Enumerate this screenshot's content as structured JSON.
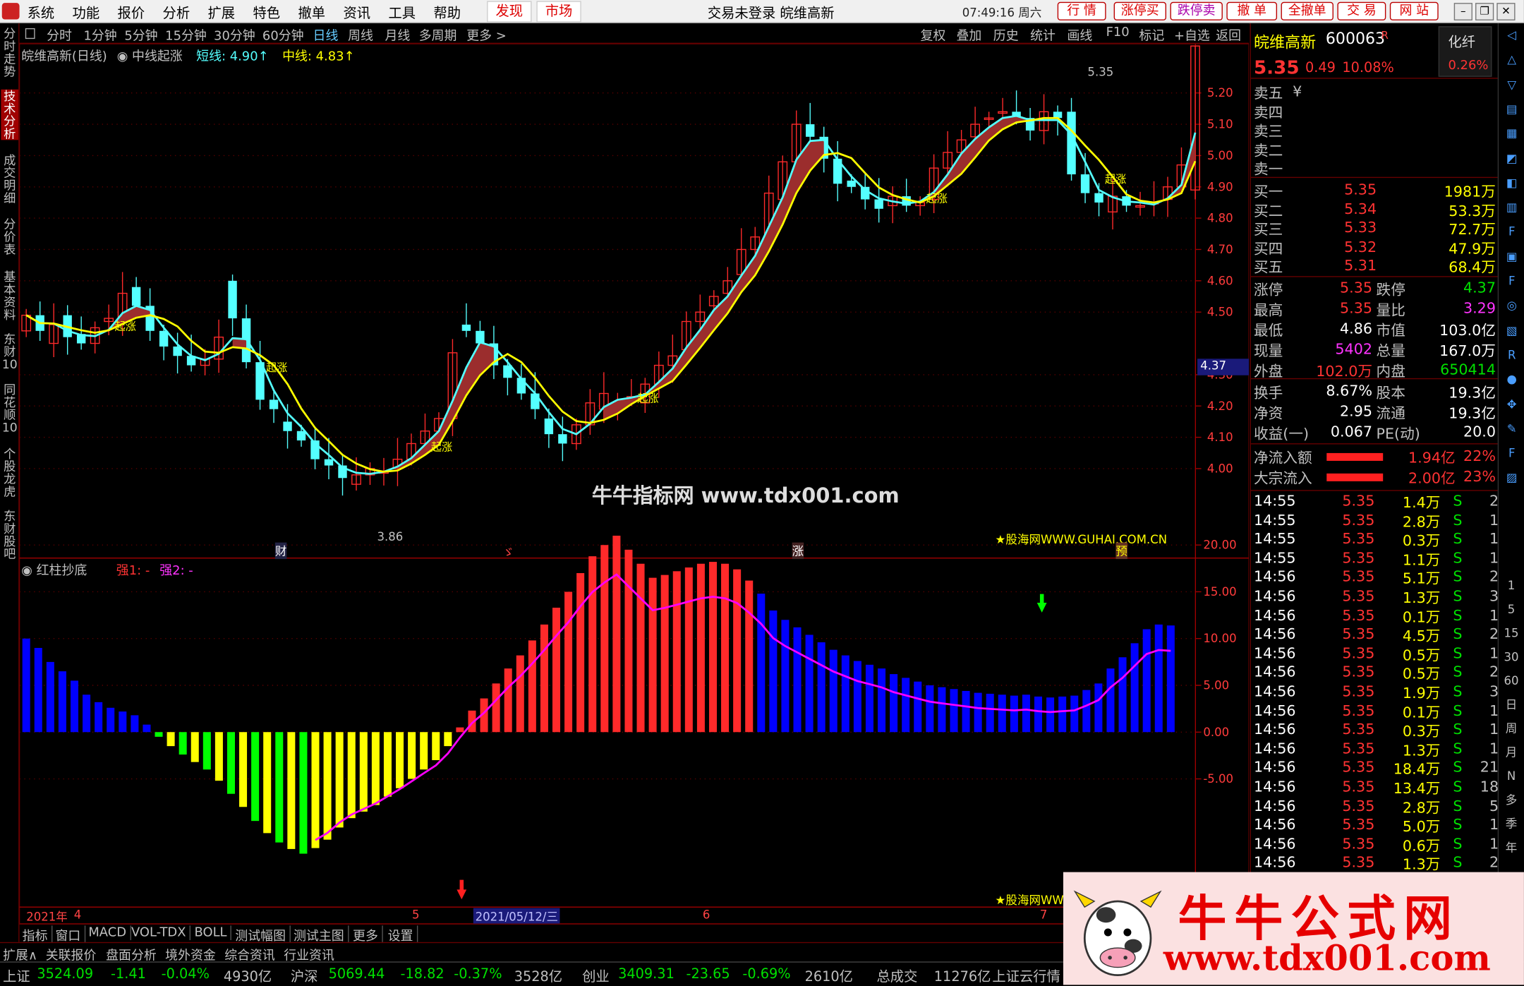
{
  "title_bar": {
    "menus": [
      "系统",
      "功能",
      "报价",
      "分析",
      "扩展",
      "特色",
      "撤单",
      "资讯",
      "工具",
      "帮助"
    ],
    "discover": "发现",
    "market": "市场",
    "center_text": "交易未登录 皖维高新",
    "clock": "07:49:16 周六",
    "buttons": [
      "行 情",
      "涨停买",
      "跌停卖",
      "撤 单",
      "全撤单",
      "交 易",
      "网 站"
    ]
  },
  "left_tabs": [
    "分时走势",
    "技术分析",
    "成交明细",
    "分价表",
    "基本资料",
    "东财10",
    "同花顺10",
    "个股龙虎",
    "东财股吧"
  ],
  "period_bar": {
    "items": [
      "分时",
      "1分钟",
      "5分钟",
      "15分钟",
      "30分钟",
      "60分钟",
      "日线",
      "周线",
      "月线",
      "多周期",
      "更多 >"
    ],
    "selected": "日线",
    "right_items": [
      "复权",
      "叠加",
      "历史",
      "统计",
      "画线",
      "F10",
      "标记",
      "+自选",
      "返回"
    ]
  },
  "main_chart": {
    "stock_label": "皖维高新(日线)",
    "indicator_name": "中线起涨",
    "short_label": "短线: 4.90↑",
    "mid_label": "中线: 4.83↑",
    "high_mark": "5.35",
    "low_mark": "3.86",
    "price_tag": "4.37",
    "marker_text": "起涨",
    "event_markers": [
      "财",
      "ゞ",
      "涨",
      "预"
    ],
    "watermark_center": "牛牛指标网 www.tdx001.com",
    "watermark_guhai": "★股海网WWW.GUHAI.COM.CN",
    "y_ticks": [
      "5.20",
      "5.10",
      "5.00",
      "4.90",
      "4.80",
      "4.70",
      "4.60",
      "4.50",
      "4.30",
      "4.20",
      "4.10",
      "4.00"
    ]
  },
  "sub_chart": {
    "indicator_name": "红柱抄底",
    "strong1": "强1: -",
    "strong2": "强2: -",
    "y_ticks": [
      "20.00",
      "15.00",
      "10.00",
      "5.00",
      "0.00",
      "-5.00"
    ],
    "watermark_guhai": "★股海网WW"
  },
  "chart_data": {
    "type": "bar",
    "title": "红柱抄底",
    "ylim": [
      -13,
      21
    ],
    "values": [
      10,
      9,
      7.5,
      6.5,
      5.5,
      4,
      3.2,
      2.6,
      2.2,
      1.8,
      0.8,
      -0.5,
      -1.5,
      -2.4,
      -3.2,
      -4,
      -5.2,
      -6.6,
      -8,
      -9.5,
      -10.8,
      -11.8,
      -12.5,
      -13,
      -12.4,
      -11.5,
      -10.2,
      -9.2,
      -8.5,
      -7.8,
      -6.9,
      -6,
      -5,
      -4,
      -3,
      -1.5,
      0.5,
      2.3,
      3.6,
      5.2,
      6.8,
      8.2,
      9.8,
      11.5,
      13.3,
      15,
      17,
      18.8,
      20,
      21,
      19.5,
      18,
      16.5,
      16.8,
      17.2,
      17.6,
      18,
      18.2,
      18,
      17.4,
      16.2,
      14.8,
      13,
      12,
      11.2,
      10.4,
      9.6,
      8.8,
      8.2,
      7.6,
      7.2,
      6.8,
      6.2,
      5.8,
      5.4,
      5,
      4.8,
      4.6,
      4.4,
      4.2,
      4.1,
      4,
      3.9,
      4,
      3.8,
      3.7,
      3.8,
      3.9,
      4.5,
      5.2,
      6.8,
      8,
      9.5,
      11,
      11.5,
      11.4
    ],
    "x": [
      "2021年4",
      "5",
      "2021/05/12/三",
      "6",
      "7"
    ]
  },
  "time_axis": {
    "labels": [
      "2021年",
      "4",
      "5",
      "2021/05/12/三",
      "6",
      "7"
    ]
  },
  "bottom_tabs": [
    "指标",
    "窗口",
    "MACD",
    "VOL-TDX",
    "BOLL",
    "测试幅图",
    "测试主图",
    "更多",
    "设置"
  ],
  "bottom_tabs2": [
    "扩展∧",
    "关联报价",
    "盘面分析",
    "境外资金",
    "综合资讯",
    "行业资讯"
  ],
  "status_bar": {
    "sh_label": "上证",
    "sh_value": "3524.09",
    "sh_change": "-1.41",
    "sh_pct": "-0.04%",
    "sh_amount": "4930亿",
    "hs_label": "沪深",
    "hs_value": "5069.44",
    "hs_change": "-18.82",
    "hs_pct": "-0.37%",
    "hs_amount": "3528亿",
    "cy_label": "创业",
    "cy_value": "3409.31",
    "cy_change": "-23.65",
    "cy_pct": "-0.69%",
    "cy_amount": "2610亿",
    "total_label": "总成交",
    "total_value": "11276亿",
    "news": "上证云行情"
  },
  "quote_panel": {
    "name": "皖维高新",
    "code": "600063",
    "code_mark": "R",
    "finance_btn": "化纤",
    "finance_pct": "0.26%",
    "price": "5.35",
    "change": "0.49",
    "pct": "10.08%",
    "sells": [
      "卖五",
      "卖四",
      "卖三",
      "卖二",
      "卖一"
    ],
    "sell_mark": "¥",
    "buys": [
      {
        "label": "买一",
        "price": "5.35",
        "vol": "1981万"
      },
      {
        "label": "买二",
        "price": "5.34",
        "vol": "53.3万"
      },
      {
        "label": "买三",
        "price": "5.33",
        "vol": "72.7万"
      },
      {
        "label": "买四",
        "price": "5.32",
        "vol": "47.9万"
      },
      {
        "label": "买五",
        "price": "5.31",
        "vol": "68.4万"
      }
    ],
    "stats": [
      {
        "l1": "涨停",
        "v1": "5.35",
        "l2": "跌停",
        "v2": "4.37"
      },
      {
        "l1": "最高",
        "v1": "5.35",
        "l2": "量比",
        "v2": "3.29"
      },
      {
        "l1": "最低",
        "v1": "4.86",
        "l2": "市值",
        "v2": "103.0亿"
      },
      {
        "l1": "现量",
        "v1": "5402",
        "l2": "总量",
        "v2": "167.0万"
      },
      {
        "l1": "外盘",
        "v1": "102.0万",
        "l2": "内盘",
        "v2": "650414"
      }
    ],
    "stats2": [
      {
        "l1": "换手",
        "v1": "8.67%",
        "l2": "股本",
        "v2": "19.3亿"
      },
      {
        "l1": "净资",
        "v1": "2.95",
        "l2": "流通",
        "v2": "19.3亿"
      },
      {
        "l1": "收益(一)",
        "v1": "0.067",
        "l2": "PE(动)",
        "v2": "20.0"
      }
    ],
    "flows": [
      {
        "label": "净流入额",
        "value": "1.94亿",
        "pct": "22%"
      },
      {
        "label": "大宗流入",
        "value": "2.00亿",
        "pct": "23%"
      }
    ],
    "ticks": [
      {
        "t": "14:55",
        "p": "5.35",
        "v": "1.4万",
        "s": "S",
        "n": "2"
      },
      {
        "t": "14:55",
        "p": "5.35",
        "v": "2.8万",
        "s": "S",
        "n": "1"
      },
      {
        "t": "14:55",
        "p": "5.35",
        "v": "0.3万",
        "s": "S",
        "n": "1"
      },
      {
        "t": "14:55",
        "p": "5.35",
        "v": "1.1万",
        "s": "S",
        "n": "1"
      },
      {
        "t": "14:56",
        "p": "5.35",
        "v": "5.1万",
        "s": "S",
        "n": "2"
      },
      {
        "t": "14:56",
        "p": "5.35",
        "v": "1.3万",
        "s": "S",
        "n": "3"
      },
      {
        "t": "14:56",
        "p": "5.35",
        "v": "0.1万",
        "s": "S",
        "n": "1"
      },
      {
        "t": "14:56",
        "p": "5.35",
        "v": "4.5万",
        "s": "S",
        "n": "2"
      },
      {
        "t": "14:56",
        "p": "5.35",
        "v": "0.5万",
        "s": "S",
        "n": "1"
      },
      {
        "t": "14:56",
        "p": "5.35",
        "v": "0.5万",
        "s": "S",
        "n": "2"
      },
      {
        "t": "14:56",
        "p": "5.35",
        "v": "1.9万",
        "s": "S",
        "n": "3"
      },
      {
        "t": "14:56",
        "p": "5.35",
        "v": "0.1万",
        "s": "S",
        "n": "1"
      },
      {
        "t": "14:56",
        "p": "5.35",
        "v": "0.3万",
        "s": "S",
        "n": "1"
      },
      {
        "t": "14:56",
        "p": "5.35",
        "v": "1.3万",
        "s": "S",
        "n": "1"
      },
      {
        "t": "14:56",
        "p": "5.35",
        "v": "18.4万",
        "s": "S",
        "n": "21"
      },
      {
        "t": "14:56",
        "p": "5.35",
        "v": "13.4万",
        "s": "S",
        "n": "18"
      },
      {
        "t": "14:56",
        "p": "5.35",
        "v": "2.8万",
        "s": "S",
        "n": "5"
      },
      {
        "t": "14:56",
        "p": "5.35",
        "v": "5.0万",
        "s": "S",
        "n": "1"
      },
      {
        "t": "14:56",
        "p": "5.35",
        "v": "0.6万",
        "s": "S",
        "n": "1"
      },
      {
        "t": "14:56",
        "p": "5.35",
        "v": "1.3万",
        "s": "S",
        "n": "2"
      }
    ]
  },
  "right_toolbar": [
    "1",
    "5",
    "15",
    "30",
    "60",
    "日",
    "周",
    "月",
    "N",
    "多",
    "季",
    "年"
  ],
  "banner": {
    "title": "牛牛公式网",
    "url": "www.tdx001.com"
  },
  "colors": {
    "up_red": "#ff2a2a",
    "down_cyan": "#54ffff",
    "yellow": "#ffff00",
    "magenta": "#ff00ff",
    "blue_bar": "#0000ff",
    "green_bar": "#00ff00",
    "fill_brown": "#9b2d2d",
    "grid_red": "#7a0000"
  }
}
